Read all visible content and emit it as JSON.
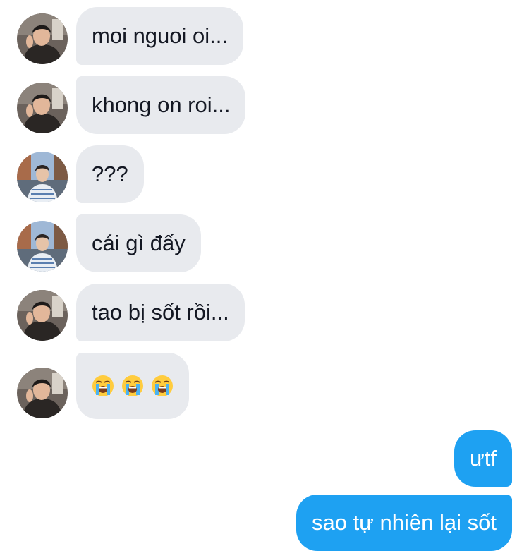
{
  "messages": [
    {
      "sender": "friend_a",
      "text": "moi nguoi oi..."
    },
    {
      "sender": "friend_a",
      "text": "khong on roi..."
    },
    {
      "sender": "friend_b",
      "text": "???"
    },
    {
      "sender": "friend_b",
      "text": "cái gì đấy"
    },
    {
      "sender": "friend_a",
      "text": "tao bị sốt rồi..."
    },
    {
      "sender": "friend_a",
      "text": "",
      "emoji": [
        "loudly-crying-face",
        "loudly-crying-face",
        "loudly-crying-face"
      ]
    }
  ],
  "outgoing": [
    {
      "text": "ưtf"
    },
    {
      "text": "sao tự nhiên lại sốt"
    }
  ],
  "colors": {
    "incoming_bubble": "#e8eaee",
    "outgoing_bubble": "#1ea1f2",
    "incoming_text": "#141823",
    "outgoing_text": "#ffffff"
  }
}
